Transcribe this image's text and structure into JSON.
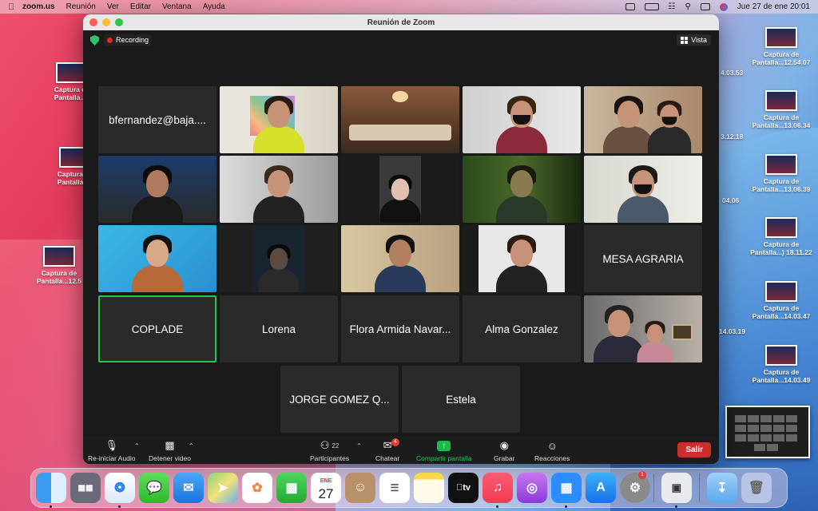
{
  "menubar": {
    "app_name": "zoom.us",
    "items": [
      "Reunión",
      "Ver",
      "Editar",
      "Ventana",
      "Ayuda"
    ],
    "clock": "Jue 27 de ene  20:01"
  },
  "desktop": {
    "left_icons": [
      {
        "line1": "Captura de",
        "line2": "Pantalla...1"
      },
      {
        "line1": "Captura de",
        "line2": "Pantalla...1"
      },
      {
        "line1": "Captura de",
        "line2": "Pantalla...12.5"
      }
    ],
    "right_icons": [
      {
        "line1": "Captura de",
        "line2": "Pantalla...12.54.07"
      },
      {
        "line1": "Captura de",
        "line2": "Pantalla...13.06.34"
      },
      {
        "line1": "Captura de",
        "line2": "Pantalla...13.06.39"
      },
      {
        "line1": "Captura de",
        "line2": "Pantalla...) 18.11.22"
      },
      {
        "line1": "Captura de",
        "line2": "Pantalla...14.03.47"
      },
      {
        "line1": "Captura de",
        "line2": "Pantalla...14.03.49"
      }
    ],
    "peek_labels": [
      "4.03.53",
      "3.12.18",
      "04.06",
      "14.03.19"
    ]
  },
  "window": {
    "title": "Reunión de Zoom",
    "recording_label": "Recording",
    "view_label": "Vista"
  },
  "participants": [
    {
      "name": "bfernandez@baja....",
      "video": false
    },
    {
      "name": "",
      "video": true
    },
    {
      "name": "",
      "video": true
    },
    {
      "name": "",
      "video": true
    },
    {
      "name": "",
      "video": true
    },
    {
      "name": "",
      "video": true
    },
    {
      "name": "",
      "video": true
    },
    {
      "name": "",
      "video": true
    },
    {
      "name": "",
      "video": true
    },
    {
      "name": "",
      "video": true
    },
    {
      "name": "",
      "video": true
    },
    {
      "name": "",
      "video": true
    },
    {
      "name": "",
      "video": true
    },
    {
      "name": "",
      "video": true
    },
    {
      "name": "MESA AGRARIA",
      "video": false
    },
    {
      "name": "COPLADE",
      "video": false,
      "active_speaker": true
    },
    {
      "name": "Lorena",
      "video": false
    },
    {
      "name": "Flora Armida Navar...",
      "video": false
    },
    {
      "name": "Alma Gonzalez",
      "video": false
    },
    {
      "name": "",
      "video": true
    },
    {
      "name": "JORGE GOMEZ Q...",
      "video": false
    },
    {
      "name": "Estela",
      "video": false
    }
  ],
  "toolbar": {
    "audio_label": "Re-iniciar Audio",
    "video_label": "Detener video",
    "participants_label": "Participantes",
    "participants_count": "22",
    "chat_label": "Chatear",
    "chat_badge": "4",
    "share_label": "Compartir pantalla",
    "record_label": "Grabar",
    "reactions_label": "Reacciones",
    "leave_label": "Salir"
  },
  "dock": {
    "calendar_month": "ENE",
    "calendar_day": "27",
    "tv_label": "tv",
    "settings_badge": "1"
  },
  "colors": {
    "active_speaker": "#2ec24a",
    "share_green": "#1fb84c",
    "leave_red": "#c9302c",
    "recording_red": "#e02a2a"
  }
}
